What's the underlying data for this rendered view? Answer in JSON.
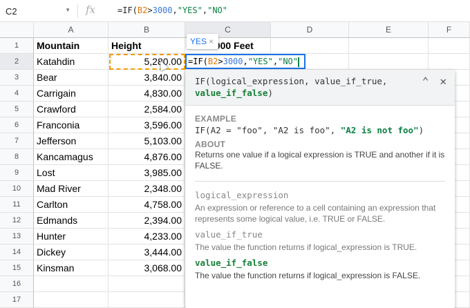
{
  "formula_bar": {
    "name_box": "C2",
    "fx": "fx",
    "formula_parts": [
      "=IF(",
      "B2",
      ">",
      "3000",
      ",",
      "\"YES\"",
      ",",
      "\"NO\""
    ]
  },
  "columns": [
    "A",
    "B",
    "C",
    "D",
    "E",
    "F"
  ],
  "rows": [
    {
      "n": "1",
      "a": "Mountain",
      "b": "Height",
      "c": "3000 Feet"
    },
    {
      "n": "2",
      "a": "Katahdin",
      "b": "5,280.00"
    },
    {
      "n": "3",
      "a": "Bear",
      "b": "3,840.00"
    },
    {
      "n": "4",
      "a": "Carrigain",
      "b": "4,830.00"
    },
    {
      "n": "5",
      "a": "Crawford",
      "b": "2,584.00"
    },
    {
      "n": "6",
      "a": "Franconia",
      "b": "3,596.00"
    },
    {
      "n": "7",
      "a": "Jefferson",
      "b": "5,103.00"
    },
    {
      "n": "8",
      "a": "Kancamagus",
      "b": "4,876.00"
    },
    {
      "n": "9",
      "a": "Lost",
      "b": "3,985.00"
    },
    {
      "n": "10",
      "a": "Mad River",
      "b": "2,348.00"
    },
    {
      "n": "11",
      "a": "Carlton",
      "b": "4,758.00"
    },
    {
      "n": "12",
      "a": "Edmands",
      "b": "2,394.00"
    },
    {
      "n": "13",
      "a": "Hunter",
      "b": "4,233.00"
    },
    {
      "n": "14",
      "a": "Dickey",
      "b": "3,444.00"
    },
    {
      "n": "15",
      "a": "Kinsman",
      "b": "3,068.00"
    },
    {
      "n": "16",
      "a": "",
      "b": ""
    },
    {
      "n": "17",
      "a": "",
      "b": ""
    }
  ],
  "tooltip": {
    "value": "YES",
    "close": "×"
  },
  "help": {
    "signature_main": "IF(logical_expression, value_if_true,",
    "signature_last": "value_if_false",
    "signature_end": ")",
    "collapse": "⌃",
    "close": "✕",
    "example_label": "EXAMPLE",
    "example_main": "IF(A2 = \"foo\", \"A2 is foo\", ",
    "example_last": "\"A2 is not foo\"",
    "example_end": ")",
    "about_label": "ABOUT",
    "about_text": "Returns one value if a logical expression is TRUE and another if it is FALSE.",
    "args": [
      {
        "name": "logical_expression",
        "desc": "An expression or reference to a cell containing an expression that represents some logical value, i.e. TRUE or FALSE."
      },
      {
        "name": "value_if_true",
        "desc": "The value the function returns if logical_expression is TRUE."
      },
      {
        "name": "value_if_false",
        "desc": "The value the function returns if logical_expression is FALSE."
      }
    ]
  }
}
